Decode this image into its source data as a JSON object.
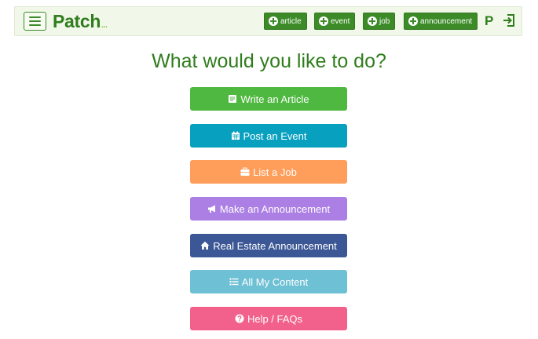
{
  "header": {
    "brand": "Patch",
    "brand_suffix": "...",
    "menu_icon": "hamburger-icon",
    "add_buttons": [
      {
        "label": "article",
        "icon": "plus-circle-icon"
      },
      {
        "label": "event",
        "icon": "plus-circle-icon"
      },
      {
        "label": "job",
        "icon": "plus-circle-icon"
      },
      {
        "label": "announcement",
        "icon": "plus-circle-icon"
      }
    ],
    "profile_initial": "P",
    "signout_icon": "sign-out-icon",
    "colors": {
      "brand_green": "#2f7d1c",
      "button_green": "#3c8b28",
      "bar_bg": "#f1f8ea"
    }
  },
  "main": {
    "title": "What would you like to do?",
    "actions": [
      {
        "label": "Write an Article",
        "icon": "document-icon",
        "color": "#4fb840"
      },
      {
        "label": "Post an Event",
        "icon": "calendar-icon",
        "color": "#08a0bf"
      },
      {
        "label": "List a Job",
        "icon": "briefcase-icon",
        "color": "#ff9e5a"
      },
      {
        "label": "Make an Announcement",
        "icon": "megaphone-icon",
        "color": "#ac7fe4"
      },
      {
        "label": "Real Estate Announcement",
        "icon": "home-icon",
        "color": "#3b5795"
      },
      {
        "label": "All My Content",
        "icon": "list-icon",
        "color": "#6ec0d4"
      },
      {
        "label": "Help / FAQs",
        "icon": "question-circle-icon",
        "color": "#f2618b"
      }
    ]
  }
}
